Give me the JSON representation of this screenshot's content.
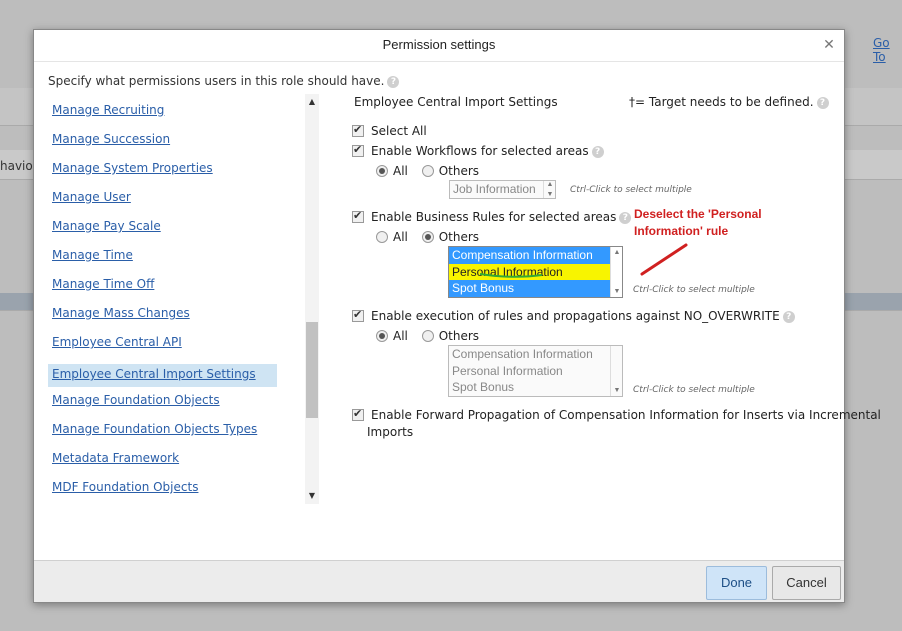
{
  "background": {
    "link": "Go To",
    "truncated_text": "havior"
  },
  "dialog": {
    "title": "Permission settings",
    "intro": "Specify what permissions users in this role should have.",
    "nav": [
      {
        "label": "Manage Recruiting"
      },
      {
        "label": "Manage Succession"
      },
      {
        "label": "Manage System Properties"
      },
      {
        "label": "Manage User"
      },
      {
        "label": "Manage Pay Scale"
      },
      {
        "label": "Manage Time"
      },
      {
        "label": "Manage Time Off"
      },
      {
        "label": "Manage Mass Changes"
      },
      {
        "label": "Employee Central API"
      },
      {
        "label": "Employee Central Import Settings",
        "selected": true
      },
      {
        "label": "Manage Foundation Objects"
      },
      {
        "label": "Manage Foundation Objects Types"
      },
      {
        "label": "Metadata Framework"
      },
      {
        "label": "MDF Foundation Objects"
      }
    ],
    "section": {
      "heading": "Employee Central Import Settings",
      "target_note": "†= Target needs to be defined.",
      "select_all": "Select All",
      "workflows": {
        "label": "Enable Workflows for selected areas",
        "all": "All",
        "others": "Others",
        "select_value": "Job Information",
        "hint": "Ctrl-Click to select multiple"
      },
      "business_rules": {
        "label": "Enable Business Rules for selected areas",
        "all": "All",
        "others": "Others",
        "options": [
          "Compensation Information",
          "Personal Information",
          "Spot Bonus"
        ],
        "hint": "Ctrl-Click to select multiple"
      },
      "overwrite": {
        "label": "Enable execution of rules and propagations against NO_OVERWRITE",
        "all": "All",
        "others": "Others",
        "options": [
          "Compensation Information",
          "Personal Information",
          "Spot Bonus"
        ],
        "hint": "Ctrl-Click to select multiple"
      },
      "forward": {
        "label_line1": "Enable Forward Propagation of Compensation Information for Inserts via Incremental",
        "label_line2": "Imports"
      }
    },
    "annotation": {
      "line1": "Deselect the 'Personal",
      "line2": "Information' rule",
      "color": "#d02020"
    },
    "buttons": {
      "done": "Done",
      "cancel": "Cancel"
    }
  }
}
